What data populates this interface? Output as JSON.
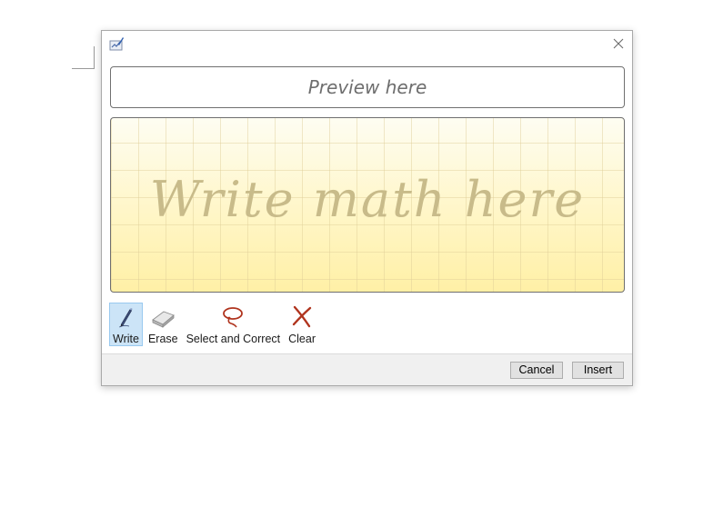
{
  "dialog": {
    "icon": "math-input-icon",
    "close_icon": "close-icon"
  },
  "preview": {
    "placeholder": "Preview here"
  },
  "writing_area": {
    "placeholder": "Write math here"
  },
  "tools": [
    {
      "id": "write",
      "label": "Write",
      "icon": "pen-icon",
      "selected": true
    },
    {
      "id": "erase",
      "label": "Erase",
      "icon": "eraser-icon",
      "selected": false
    },
    {
      "id": "select",
      "label": "Select and Correct",
      "icon": "lasso-icon",
      "selected": false
    },
    {
      "id": "clear",
      "label": "Clear",
      "icon": "clear-x-icon",
      "selected": false
    }
  ],
  "footer": {
    "cancel_label": "Cancel",
    "insert_label": "Insert"
  },
  "colors": {
    "accent_selected": "#cce4f7",
    "writing_pad": "#fff6c7",
    "placeholder_ink": "#c8bb8a",
    "clear_red": "#b0341e"
  }
}
